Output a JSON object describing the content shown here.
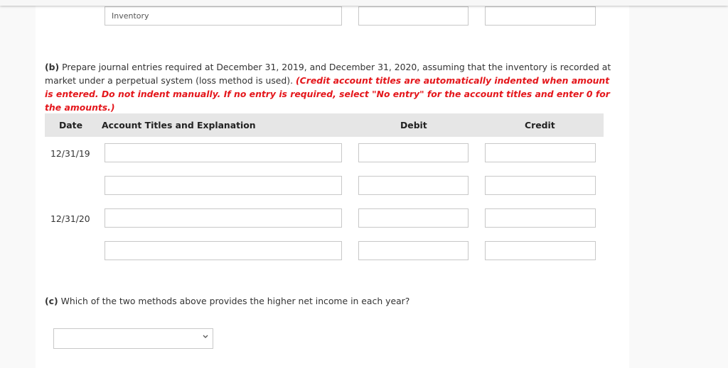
{
  "part_a_last_row": {
    "account_value": "Inventory",
    "debit_value": "",
    "credit_value": ""
  },
  "part_b": {
    "label": "(b)",
    "instruction": " Prepare journal entries required at December 31, 2019, and December 31, 2020, assuming that the inventory is recorded at market under a perpetual system (loss method is used). ",
    "note": "(Credit account titles are automatically indented when amount is entered. Do not indent manually. If no entry is required, select \"No entry\" for the account titles and enter 0 for the amounts.)",
    "table": {
      "headers": {
        "date": "Date",
        "account": "Account Titles and Explanation",
        "debit": "Debit",
        "credit": "Credit"
      },
      "rows": [
        {
          "date": "12/31/19",
          "account": "",
          "debit": "",
          "credit": ""
        },
        {
          "date": "",
          "account": "",
          "debit": "",
          "credit": ""
        },
        {
          "date": "12/31/20",
          "account": "",
          "debit": "",
          "credit": ""
        },
        {
          "date": "",
          "account": "",
          "debit": "",
          "credit": ""
        }
      ]
    }
  },
  "part_c": {
    "label": "(c)",
    "question": " Which of the two methods above provides the higher net income in each year?",
    "select_value": "",
    "chevron_icon": "chevron-down-icon"
  },
  "colors": {
    "note_red": "#e4161b",
    "header_bg": "#e6e6e6",
    "field_border": "#c8c8c8"
  }
}
